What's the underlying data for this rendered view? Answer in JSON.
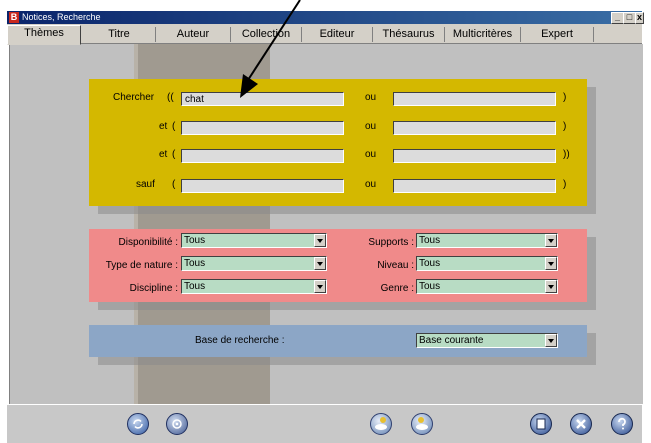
{
  "window": {
    "app_icon": "B",
    "title": "Notices, Recherche",
    "controls": [
      "_",
      "□",
      "x"
    ]
  },
  "tabs": [
    {
      "label": "Thèmes",
      "active": true
    },
    {
      "label": "Titre",
      "active": false
    },
    {
      "label": "Auteur",
      "active": false
    },
    {
      "label": "Collection",
      "active": false
    },
    {
      "label": "Editeur",
      "active": false
    },
    {
      "label": "Thésaurus",
      "active": false
    },
    {
      "label": "Multicritères",
      "active": false
    },
    {
      "label": "Expert",
      "active": false
    }
  ],
  "search_panel": {
    "color": "#d4b800",
    "rows": [
      {
        "operator": "Chercher",
        "open": "((",
        "left_value": "chat",
        "or_label": "ou",
        "right_value": "",
        "close": ")"
      },
      {
        "operator": "et",
        "open": "(",
        "left_value": "",
        "or_label": "ou",
        "right_value": "",
        "close": ")"
      },
      {
        "operator": "et",
        "open": "(",
        "left_value": "",
        "or_label": "ou",
        "right_value": "",
        "close": "))"
      },
      {
        "operator": "sauf",
        "open": "(",
        "left_value": "",
        "or_label": "ou",
        "right_value": "",
        "close": ")"
      }
    ]
  },
  "filter_panel": {
    "color": "#f08080",
    "left": [
      {
        "label": "Disponibilité :",
        "value": "Tous"
      },
      {
        "label": "Type de nature :",
        "value": "Tous"
      },
      {
        "label": "Discipline :",
        "value": "Tous"
      }
    ],
    "right": [
      {
        "label": "Supports :",
        "value": "Tous"
      },
      {
        "label": "Niveau :",
        "value": "Tous"
      },
      {
        "label": "Genre :",
        "value": "Tous"
      }
    ]
  },
  "base_panel": {
    "color": "#8ca8c8",
    "label": "Base de recherche :",
    "value": "Base courante"
  },
  "toolbar": {
    "icons": [
      "refresh-icon",
      "settings-icon",
      "search-globe-icon",
      "search-globe-alt-icon",
      "notebook-icon",
      "close-icon",
      "help-icon"
    ]
  }
}
